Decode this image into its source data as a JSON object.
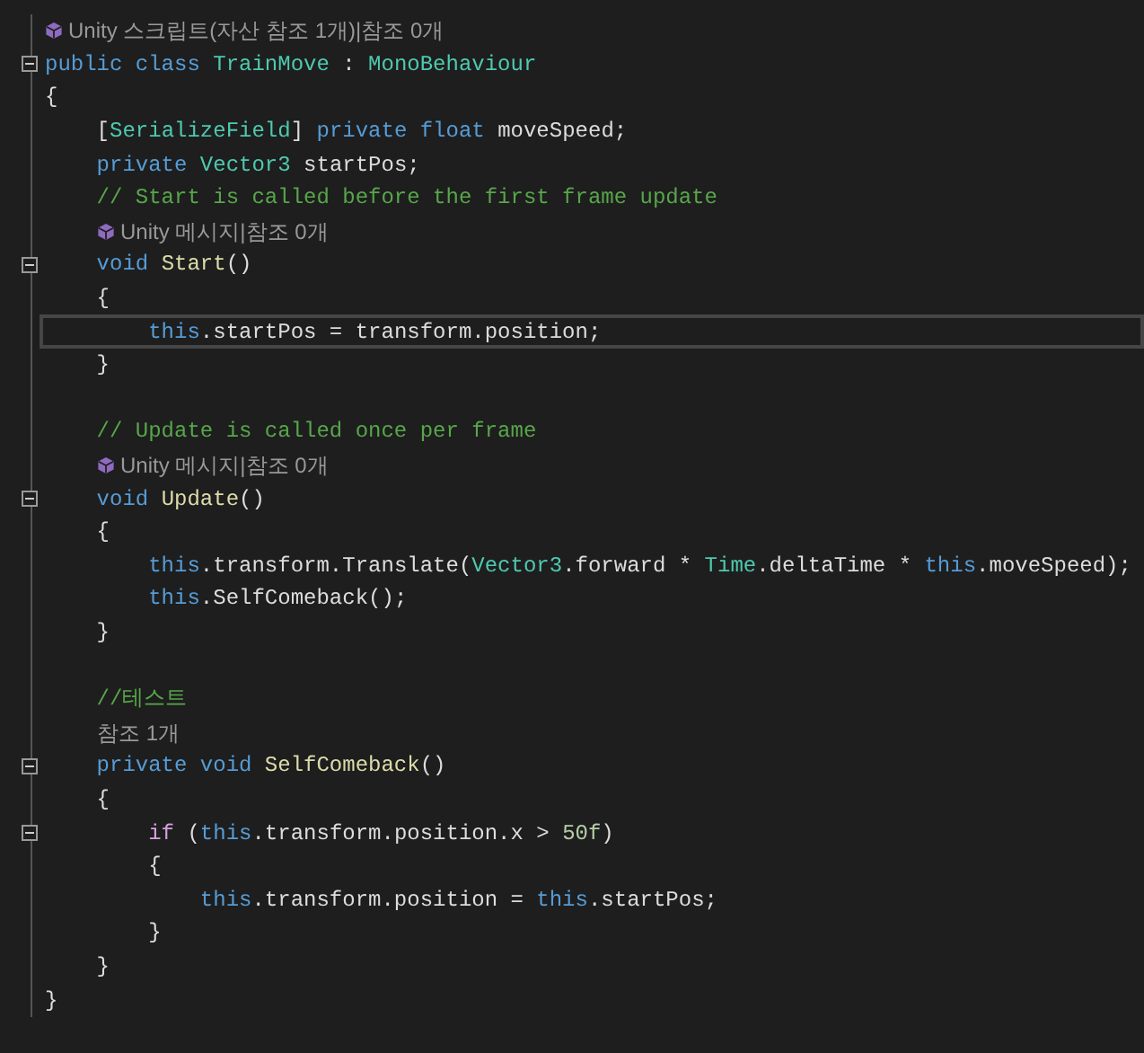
{
  "editor": {
    "lines": [
      {
        "kind": "lens",
        "icon": true,
        "indented": false,
        "text": "Unity 스크립트(자산 참조 1개)|참조 0개"
      },
      {
        "kind": "code",
        "fold": true,
        "tokens": [
          {
            "t": "public class ",
            "kind": "keyword"
          },
          {
            "t": "TrainMove",
            "kind": "type"
          },
          {
            "t": " : ",
            "kind": "plain"
          },
          {
            "t": "MonoBehaviour",
            "kind": "type"
          }
        ]
      },
      {
        "kind": "code",
        "fold": false,
        "tokens": [
          {
            "t": "{",
            "kind": "plain"
          }
        ]
      },
      {
        "kind": "code",
        "fold": false,
        "tokens": [
          {
            "t": "    [",
            "kind": "plain"
          },
          {
            "t": "SerializeField",
            "kind": "type"
          },
          {
            "t": "] ",
            "kind": "plain"
          },
          {
            "t": "private float ",
            "kind": "keyword"
          },
          {
            "t": "moveSpeed;",
            "kind": "plain"
          }
        ]
      },
      {
        "kind": "code",
        "fold": false,
        "tokens": [
          {
            "t": "    private ",
            "kind": "keyword"
          },
          {
            "t": "Vector3",
            "kind": "type"
          },
          {
            "t": " startPos;",
            "kind": "plain"
          }
        ]
      },
      {
        "kind": "code",
        "fold": false,
        "tokens": [
          {
            "t": "    // Start is called before the first frame update",
            "kind": "comment"
          }
        ]
      },
      {
        "kind": "lens",
        "icon": true,
        "indented": true,
        "text": "Unity 메시지|참조 0개"
      },
      {
        "kind": "code",
        "fold": true,
        "tokens": [
          {
            "t": "    void ",
            "kind": "keyword"
          },
          {
            "t": "Start",
            "kind": "method"
          },
          {
            "t": "()",
            "kind": "plain"
          }
        ]
      },
      {
        "kind": "code",
        "fold": false,
        "tokens": [
          {
            "t": "    {",
            "kind": "plain"
          }
        ]
      },
      {
        "kind": "code",
        "fold": false,
        "current": true,
        "tokens": [
          {
            "t": "        this",
            "kind": "keyword"
          },
          {
            "t": ".startPos = transform.position;",
            "kind": "plain"
          }
        ]
      },
      {
        "kind": "code",
        "fold": false,
        "tokens": [
          {
            "t": "    }",
            "kind": "plain"
          }
        ]
      },
      {
        "kind": "blank"
      },
      {
        "kind": "code",
        "fold": false,
        "tokens": [
          {
            "t": "    // Update is called once per frame",
            "kind": "comment"
          }
        ]
      },
      {
        "kind": "lens",
        "icon": true,
        "indented": true,
        "text": "Unity 메시지|참조 0개"
      },
      {
        "kind": "code",
        "fold": true,
        "tokens": [
          {
            "t": "    void ",
            "kind": "keyword"
          },
          {
            "t": "Update",
            "kind": "method"
          },
          {
            "t": "()",
            "kind": "plain"
          }
        ]
      },
      {
        "kind": "code",
        "fold": false,
        "tokens": [
          {
            "t": "    {",
            "kind": "plain"
          }
        ]
      },
      {
        "kind": "code",
        "fold": false,
        "tokens": [
          {
            "t": "        this",
            "kind": "keyword"
          },
          {
            "t": ".transform.Translate(",
            "kind": "plain"
          },
          {
            "t": "Vector3",
            "kind": "type"
          },
          {
            "t": ".forward * ",
            "kind": "plain"
          },
          {
            "t": "Time",
            "kind": "type"
          },
          {
            "t": ".deltaTime * ",
            "kind": "plain"
          },
          {
            "t": "this",
            "kind": "keyword"
          },
          {
            "t": ".moveSpeed);",
            "kind": "plain"
          }
        ]
      },
      {
        "kind": "code",
        "fold": false,
        "tokens": [
          {
            "t": "        this",
            "kind": "keyword"
          },
          {
            "t": ".SelfComeback();",
            "kind": "plain"
          }
        ]
      },
      {
        "kind": "code",
        "fold": false,
        "tokens": [
          {
            "t": "    }",
            "kind": "plain"
          }
        ]
      },
      {
        "kind": "blank"
      },
      {
        "kind": "code",
        "fold": false,
        "tokens": [
          {
            "t": "    //테스트",
            "kind": "comment"
          }
        ]
      },
      {
        "kind": "lens",
        "icon": false,
        "indented": true,
        "text": "참조 1개"
      },
      {
        "kind": "code",
        "fold": true,
        "tokens": [
          {
            "t": "    private void ",
            "kind": "keyword"
          },
          {
            "t": "SelfComeback",
            "kind": "method"
          },
          {
            "t": "()",
            "kind": "plain"
          }
        ]
      },
      {
        "kind": "code",
        "fold": false,
        "tokens": [
          {
            "t": "    {",
            "kind": "plain"
          }
        ]
      },
      {
        "kind": "code",
        "fold": true,
        "tokens": [
          {
            "t": "        if",
            "kind": "control"
          },
          {
            "t": " (",
            "kind": "plain"
          },
          {
            "t": "this",
            "kind": "keyword"
          },
          {
            "t": ".transform.position.x > ",
            "kind": "plain"
          },
          {
            "t": "50f",
            "kind": "number"
          },
          {
            "t": ")",
            "kind": "plain"
          }
        ]
      },
      {
        "kind": "code",
        "fold": false,
        "tokens": [
          {
            "t": "        {",
            "kind": "plain"
          }
        ]
      },
      {
        "kind": "code",
        "fold": false,
        "tokens": [
          {
            "t": "            this",
            "kind": "keyword"
          },
          {
            "t": ".transform.position = ",
            "kind": "plain"
          },
          {
            "t": "this",
            "kind": "keyword"
          },
          {
            "t": ".startPos;",
            "kind": "plain"
          }
        ]
      },
      {
        "kind": "code",
        "fold": false,
        "tokens": [
          {
            "t": "        }",
            "kind": "plain"
          }
        ]
      },
      {
        "kind": "code",
        "fold": false,
        "tokens": [
          {
            "t": "    }",
            "kind": "plain"
          }
        ]
      },
      {
        "kind": "code",
        "fold": false,
        "tokens": [
          {
            "t": "}",
            "kind": "plain"
          }
        ]
      }
    ]
  }
}
